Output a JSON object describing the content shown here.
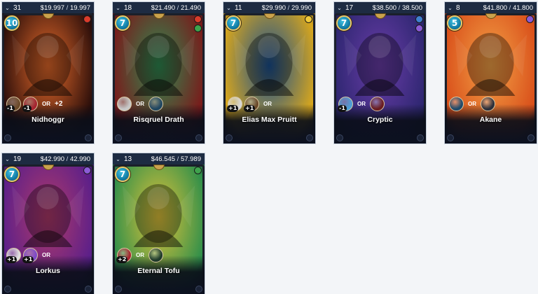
{
  "cards": [
    {
      "count": "31",
      "price": "$19.997",
      "max": "19.997",
      "mana": "10",
      "name": "Nidhoggr",
      "bg1": "#2b0e0a",
      "bg2": "#e4692a",
      "el": "#d93b2b",
      "el2": "",
      "ab": [
        {
          "c": "#6b4a2a",
          "t": "-1",
          "icon": "shield-minus-icon"
        },
        {
          "c": "#a6232f",
          "t": "-1",
          "icon": "heart-minus-icon"
        }
      ],
      "extra": "+2"
    },
    {
      "count": "18",
      "price": "$21.490",
      "max": "21.490",
      "mana": "7",
      "name": "Risqruel Drath",
      "bg1": "#7a1a1a",
      "bg2": "#2f8a52",
      "el": "#d93b2b",
      "el2": "#3fa34d",
      "ab": [
        {
          "c": "#c8c8c8",
          "t": "",
          "icon": "target-icon"
        },
        {
          "c": "#1f4660",
          "t": "",
          "icon": "wings-icon"
        }
      ],
      "extra": ""
    },
    {
      "count": "11",
      "price": "$29.990",
      "max": "29.990",
      "mana": "7",
      "name": "Elias Max Pruitt",
      "bg1": "#d9a71c",
      "bg2": "#1a4f8f",
      "el": "#f0c93a",
      "el2": "",
      "ab": [
        {
          "c": "#d8d8d8",
          "t": "+1",
          "icon": "gear-plus-icon"
        },
        {
          "c": "#6b4a2a",
          "t": "+1",
          "icon": "shield-plus-icon"
        }
      ],
      "extra": ""
    },
    {
      "count": "17",
      "price": "$38.500",
      "max": "38.500",
      "mana": "7",
      "name": "Cryptic",
      "bg1": "#2d2670",
      "bg2": "#6a3da8",
      "el": "#3f7fd0",
      "el2": "#8b5bd6",
      "ab": [
        {
          "c": "#4d9fd8",
          "t": "-1",
          "icon": "bolt-minus-icon"
        },
        {
          "c": "#6a1c20",
          "t": "",
          "icon": "skull-icon"
        }
      ],
      "extra": ""
    },
    {
      "count": "8",
      "price": "$41.800",
      "max": "41.800",
      "mana": "5",
      "name": "Akane",
      "bg1": "#d94f1a",
      "bg2": "#f2a146",
      "el": "#8b5bd6",
      "el2": "",
      "ab": [
        {
          "c": "#1f4a6a",
          "t": "",
          "icon": "mask-icon"
        },
        {
          "c": "#2b2f3a",
          "t": "",
          "icon": "eye-icon"
        }
      ],
      "extra": ""
    },
    {
      "count": "19",
      "price": "$42.990",
      "max": "42.990",
      "mana": "7",
      "name": "Lorkus",
      "bg1": "#5a1f8a",
      "bg2": "#b03a6a",
      "el": "#8b5bd6",
      "el2": "",
      "ab": [
        {
          "c": "#e0e0e0",
          "t": "+1",
          "icon": "star-plus-icon"
        },
        {
          "c": "#7d4ac8",
          "t": "+1",
          "icon": "magic-plus-icon"
        }
      ],
      "extra": ""
    },
    {
      "count": "13",
      "price": "$46.545",
      "max": "57.989",
      "mana": "7",
      "name": "Eternal Tofu",
      "bg1": "#2f8f4a",
      "bg2": "#e0c23a",
      "el": "#3fa34d",
      "el2": "",
      "ab": [
        {
          "c": "#a6232f",
          "t": "+2",
          "icon": "heart-plus-icon"
        },
        {
          "c": "#1f3a2a",
          "t": "",
          "icon": "leaf-icon"
        }
      ],
      "extra": ""
    }
  ],
  "labels": {
    "or": "OR",
    "sep": " / "
  }
}
